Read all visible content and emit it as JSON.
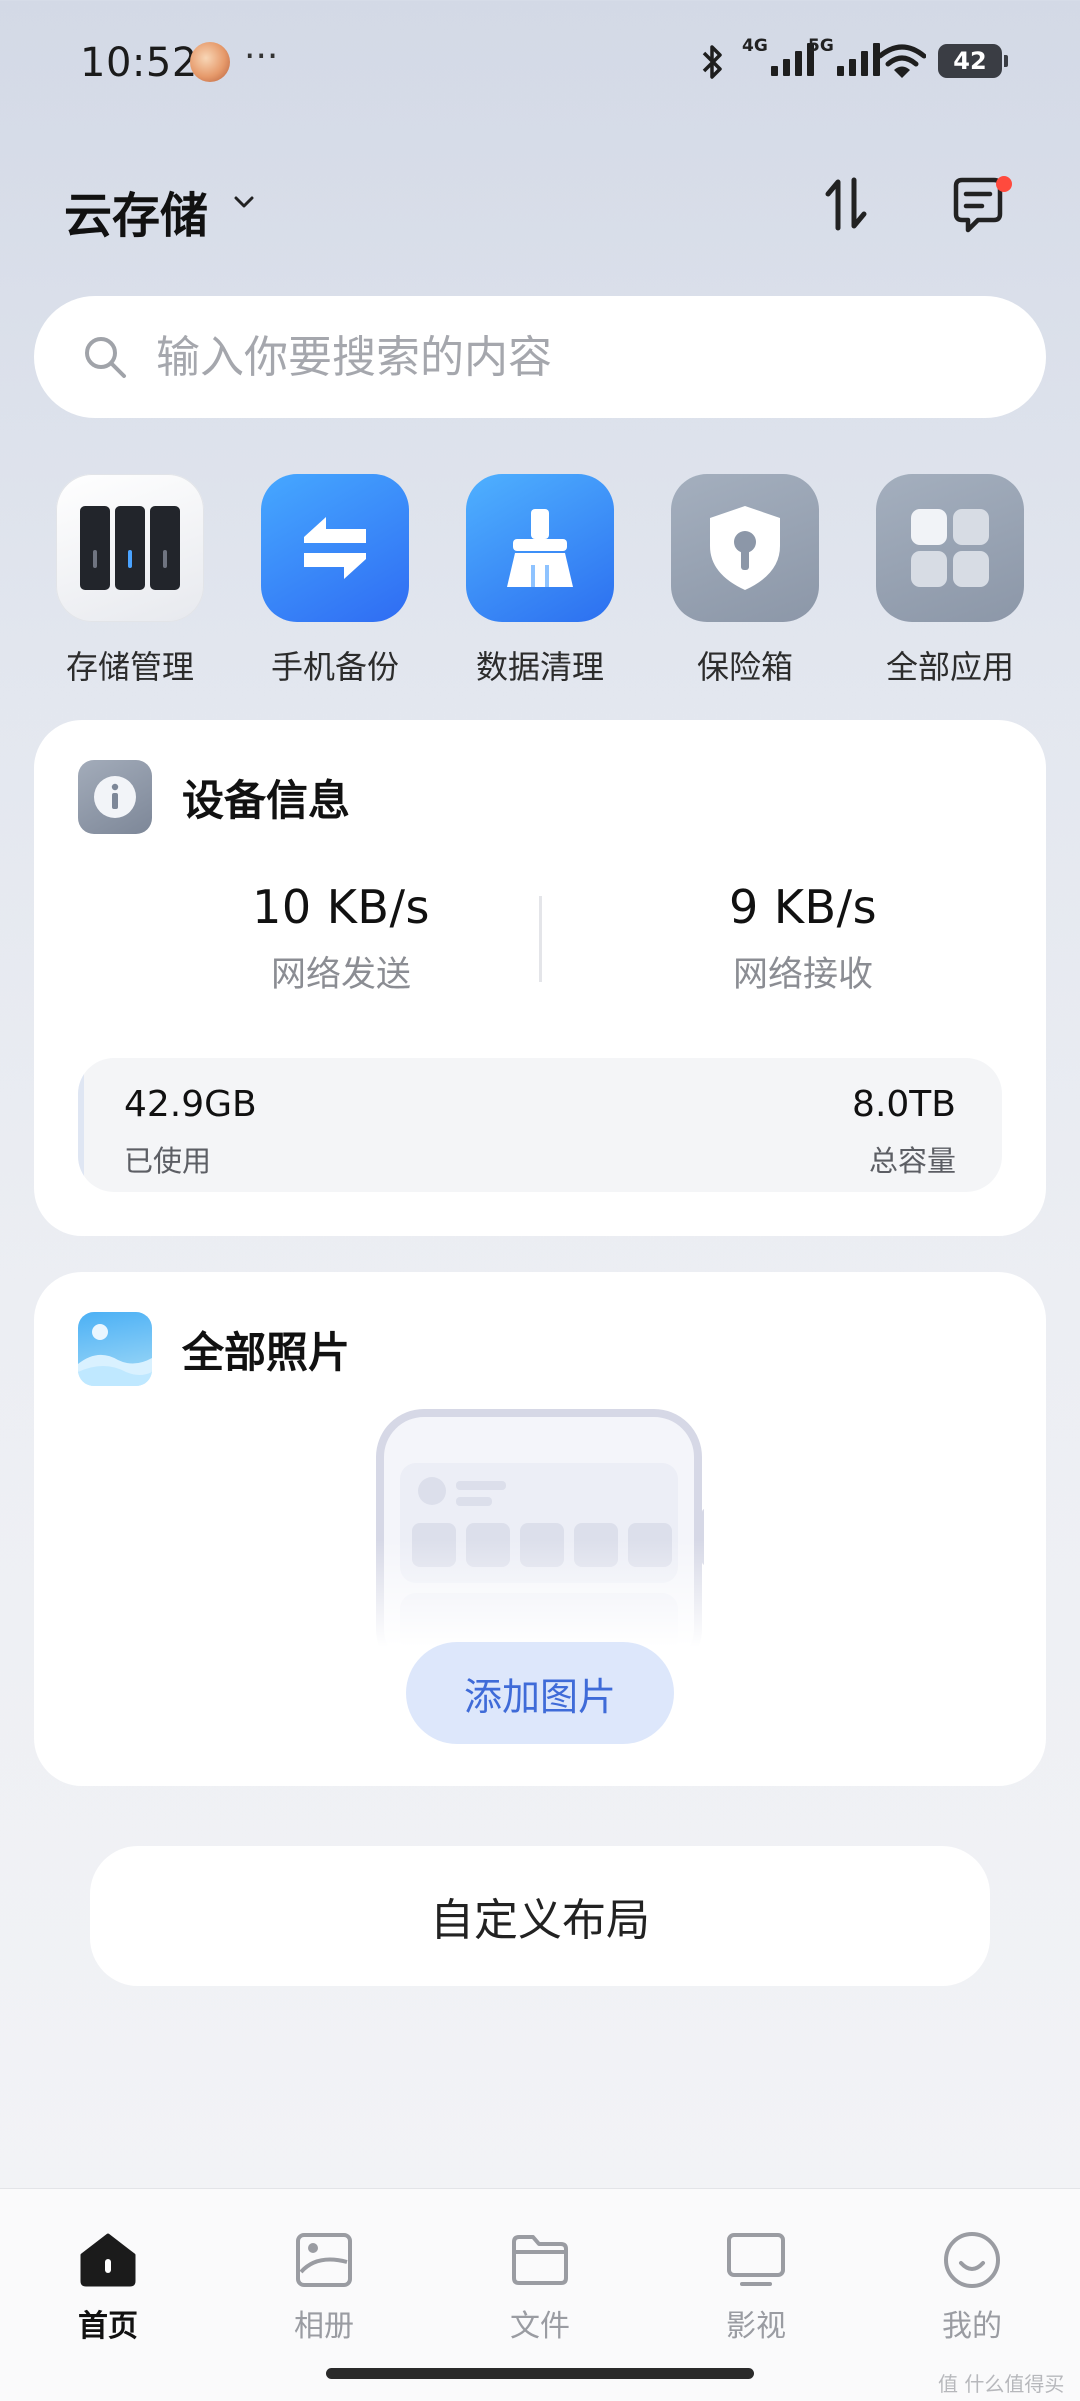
{
  "status_bar": {
    "time": "10:52",
    "dots": "···",
    "net1": "4G",
    "net2": "5G",
    "battery": "42",
    "icons": [
      "bluetooth-icon",
      "signal-icon",
      "wifi-icon",
      "battery-icon"
    ]
  },
  "header": {
    "title": "云存储",
    "icons": [
      "chevron-down-icon",
      "sort-icon",
      "message-icon"
    ]
  },
  "search": {
    "placeholder": "输入你要搜索的内容"
  },
  "quick_apps": [
    {
      "label": "存储管理",
      "icon": "storage-icon"
    },
    {
      "label": "手机备份",
      "icon": "backup-icon"
    },
    {
      "label": "数据清理",
      "icon": "cleanup-icon"
    },
    {
      "label": "保险箱",
      "icon": "safe-icon"
    },
    {
      "label": "全部应用",
      "icon": "all-apps-icon"
    }
  ],
  "device_info": {
    "title": "设备信息",
    "send_value": "10 KB/s",
    "send_label": "网络发送",
    "receive_value": "9 KB/s",
    "receive_label": "网络接收",
    "used_value": "42.9GB",
    "used_label": "已使用",
    "total_value": "8.0TB",
    "total_label": "总容量",
    "used_fraction": 0.005
  },
  "photos": {
    "title": "全部照片",
    "add_button": "添加图片"
  },
  "custom_layout": "自定义布局",
  "bottom_nav": [
    {
      "label": "首页",
      "icon": "home-icon",
      "active": true
    },
    {
      "label": "相册",
      "icon": "album-icon",
      "active": false
    },
    {
      "label": "文件",
      "icon": "folder-icon",
      "active": false
    },
    {
      "label": "影视",
      "icon": "tv-icon",
      "active": false
    },
    {
      "label": "我的",
      "icon": "profile-icon",
      "active": false
    }
  ],
  "watermark": "值 什么值得买",
  "colors": {
    "accent_blue": "#3f6bd8",
    "notification_red": "#ff4a3d"
  }
}
